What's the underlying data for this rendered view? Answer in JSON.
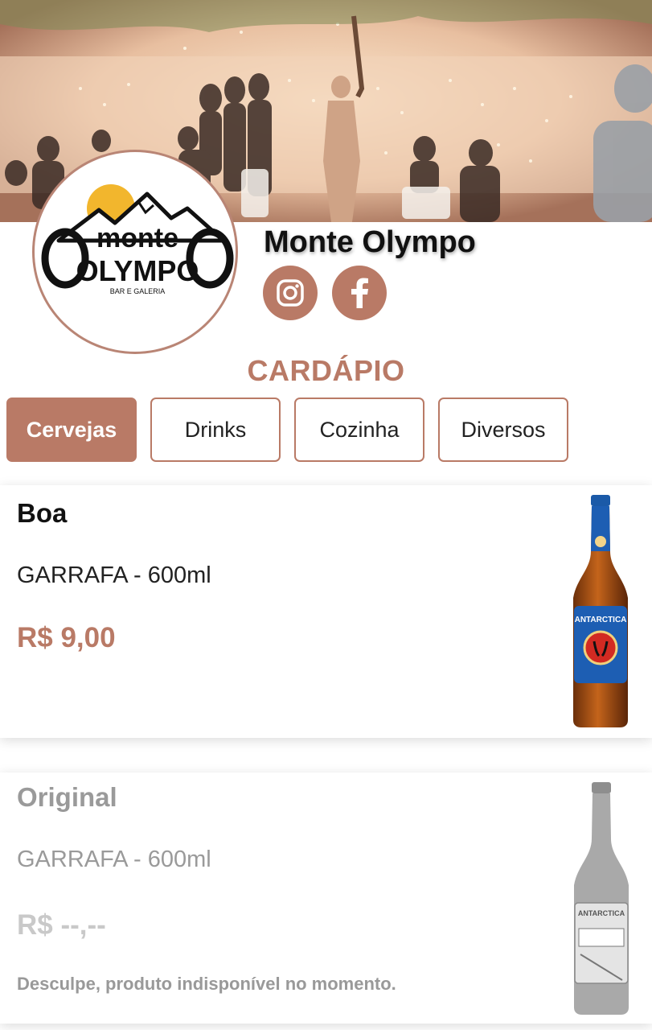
{
  "header": {
    "venue_name": "Monte Olympo",
    "cover_image": "venue-courtyard-photo",
    "logo": {
      "top_text": "monte",
      "main_text": "OLYMPO",
      "sub_text": "BAR E GALERIA"
    },
    "social": [
      {
        "name": "Instagram",
        "icon": "instagram-icon"
      },
      {
        "name": "Facebook",
        "icon": "facebook-icon"
      }
    ]
  },
  "menu": {
    "title": "CARDÁPIO",
    "tabs": [
      {
        "label": "Cervejas",
        "active": true
      },
      {
        "label": "Drinks",
        "active": false
      },
      {
        "label": "Cozinha",
        "active": false
      },
      {
        "label": "Diversos",
        "active": false
      }
    ]
  },
  "products": [
    {
      "name": "Boa",
      "description": "GARRAFA - 600ml",
      "price": "R$ 9,00",
      "available": true,
      "bottle_label": "ANTARCTICA"
    },
    {
      "name": "Original",
      "description": "GARRAFA - 600ml",
      "price": "R$ --,--",
      "available": false,
      "unavailable_note": "Desculpe, produto indisponível no momento.",
      "bottle_label": "ANTARCTICA"
    }
  ],
  "colors": {
    "accent": "#b97a66",
    "text": "#111111",
    "disabled_text": "#9a9a9a"
  }
}
